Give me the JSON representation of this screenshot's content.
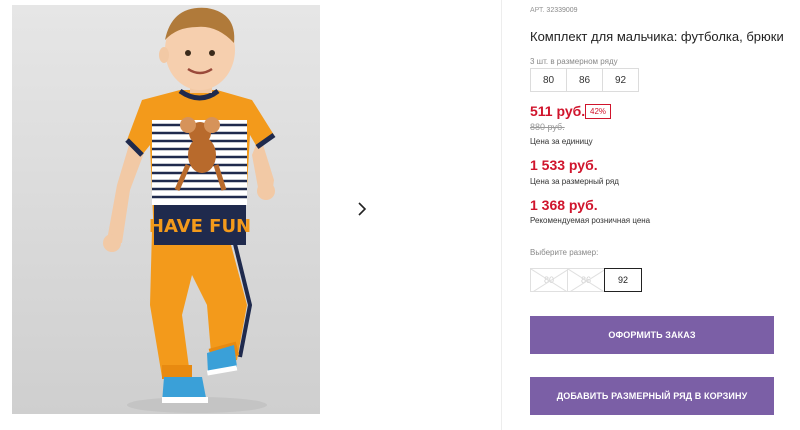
{
  "product": {
    "sku_label": "АРТ.",
    "sku": "32339009",
    "title": "Комплект для мальчика: футболка, брюки",
    "photo_alt": "Мальчик в комплекте"
  },
  "pack": {
    "label": "3 шт. в размерном ряду",
    "sizes": [
      "80",
      "86",
      "92"
    ]
  },
  "pricing": {
    "unit_price": "511 руб.",
    "discount": "42%",
    "old_price": "880 руб.",
    "unit_note": "Цена за единицу",
    "row_price": "1 533 руб.",
    "row_note": "Цена за размерный ряд",
    "rrp_price": "1 368 руб.",
    "rrp_note": "Рекомендуемая розничная цена"
  },
  "size_select": {
    "label": "Выберите размер:",
    "options": [
      {
        "label": "80",
        "available": false
      },
      {
        "label": "86",
        "available": false
      },
      {
        "label": "92",
        "available": true,
        "selected": true
      }
    ]
  },
  "actions": {
    "order": "ОФОРМИТЬ ЗАКАЗ",
    "add_row": "ДОБАВИТЬ РАЗМЕРНЫЙ РЯД В КОРЗИНУ"
  },
  "shirt_print": "HAVE FUN",
  "colors": {
    "price": "#d0142c",
    "button": "#7b5fa6",
    "shirt": "#f39a1b",
    "navy": "#1f2a4d"
  },
  "icons": {
    "next": "chevron-right-icon"
  }
}
